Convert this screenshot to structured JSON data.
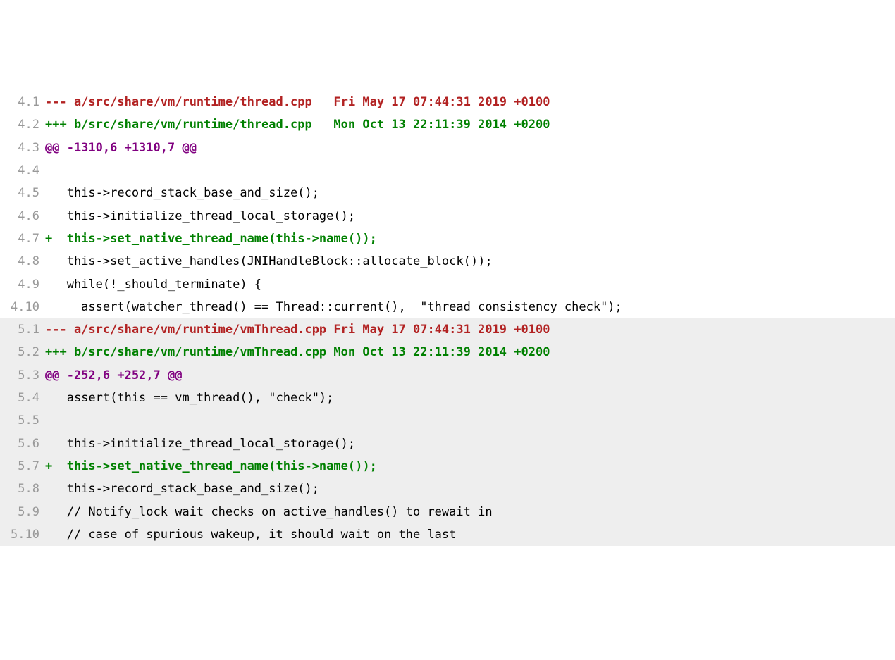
{
  "files": [
    {
      "prefix": "4",
      "bg": "white",
      "lines": [
        {
          "n": "4.1",
          "type": "minus-header",
          "text": "--- a/src/share/vm/runtime/thread.cpp\tFri May 17 07:44:31 2019 +0100"
        },
        {
          "n": "4.2",
          "type": "plus-header",
          "text": "+++ b/src/share/vm/runtime/thread.cpp\tMon Oct 13 22:11:39 2014 +0200"
        },
        {
          "n": "4.3",
          "type": "hunk",
          "text": "@@ -1310,6 +1310,7 @@"
        },
        {
          "n": "4.4",
          "type": "ctx",
          "text": " "
        },
        {
          "n": "4.5",
          "type": "ctx",
          "text": "   this->record_stack_base_and_size();"
        },
        {
          "n": "4.6",
          "type": "ctx",
          "text": "   this->initialize_thread_local_storage();"
        },
        {
          "n": "4.7",
          "type": "plus-line",
          "text": "+  this->set_native_thread_name(this->name());"
        },
        {
          "n": "4.8",
          "type": "ctx",
          "text": "   this->set_active_handles(JNIHandleBlock::allocate_block());"
        },
        {
          "n": "4.9",
          "type": "ctx",
          "text": "   while(!_should_terminate) {"
        },
        {
          "n": "4.10",
          "type": "ctx",
          "text": "     assert(watcher_thread() == Thread::current(),  \"thread consistency check\");"
        }
      ]
    },
    {
      "prefix": "5",
      "bg": "grey",
      "lines": [
        {
          "n": "5.1",
          "type": "minus-header",
          "text": "--- a/src/share/vm/runtime/vmThread.cpp\tFri May 17 07:44:31 2019 +0100"
        },
        {
          "n": "5.2",
          "type": "plus-header",
          "text": "+++ b/src/share/vm/runtime/vmThread.cpp\tMon Oct 13 22:11:39 2014 +0200"
        },
        {
          "n": "5.3",
          "type": "hunk",
          "text": "@@ -252,6 +252,7 @@"
        },
        {
          "n": "5.4",
          "type": "ctx",
          "text": "   assert(this == vm_thread(), \"check\");"
        },
        {
          "n": "5.5",
          "type": "ctx",
          "text": " "
        },
        {
          "n": "5.6",
          "type": "ctx",
          "text": "   this->initialize_thread_local_storage();"
        },
        {
          "n": "5.7",
          "type": "plus-line",
          "text": "+  this->set_native_thread_name(this->name());"
        },
        {
          "n": "5.8",
          "type": "ctx",
          "text": "   this->record_stack_base_and_size();"
        },
        {
          "n": "5.9",
          "type": "ctx",
          "text": "   // Notify_lock wait checks on active_handles() to rewait in"
        },
        {
          "n": "5.10",
          "type": "ctx",
          "text": "   // case of spurious wakeup, it should wait on the last"
        }
      ]
    }
  ]
}
